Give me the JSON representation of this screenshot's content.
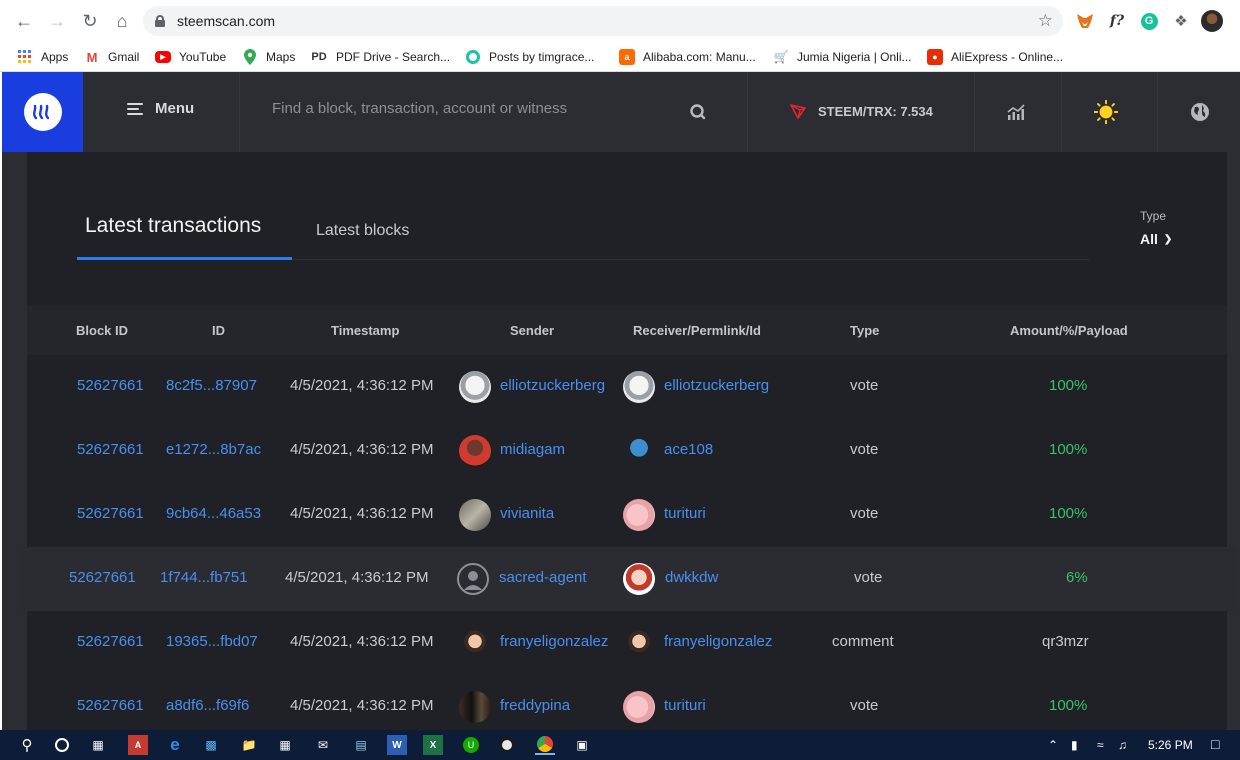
{
  "browser": {
    "url": "steemscan.com",
    "bookmarks": [
      {
        "label": "Apps",
        "icon": "apps-grid-icon",
        "color": "#4285f4"
      },
      {
        "label": "Gmail",
        "icon": "gmail-icon",
        "color": "#ea4335"
      },
      {
        "label": "YouTube",
        "icon": "youtube-icon",
        "color": "#ff0000"
      },
      {
        "label": "Maps",
        "icon": "maps-pin-icon",
        "color": "#34a853"
      },
      {
        "label": "PDF Drive - Search...",
        "icon": "pdf-drive-icon",
        "color": "#333333"
      },
      {
        "label": "Posts by timgrace...",
        "icon": "posts-icon",
        "color": "#19c3a6"
      },
      {
        "label": "Alibaba.com: Manu...",
        "icon": "alibaba-icon",
        "color": "#ff6a00"
      },
      {
        "label": "Jumia Nigeria | Onli...",
        "icon": "jumia-cart-icon",
        "color": "#444444"
      },
      {
        "label": "AliExpress - Online...",
        "icon": "aliexpress-icon",
        "color": "#e62e04"
      }
    ]
  },
  "header": {
    "menu_label": "Menu",
    "search_placeholder": "Find a block, transaction, account or witness",
    "price_label": "STEEM/TRX: 7.534",
    "accent": "#1a3de0"
  },
  "tabs": {
    "active": "Latest transactions",
    "other": "Latest blocks"
  },
  "filter": {
    "label": "Type",
    "value": "All"
  },
  "table": {
    "columns": [
      "Block ID",
      "ID",
      "Timestamp",
      "Sender",
      "Receiver/Permlink/Id",
      "Type",
      "Amount/%/Payload"
    ],
    "rows": [
      {
        "block": "52627661",
        "id": "8c2f5...87907",
        "timestamp": "4/5/2021, 4:36:12 PM",
        "sender": "elliotzuckerberg",
        "receiver": "elliotzuckerberg",
        "type": "vote",
        "amount": "100%"
      },
      {
        "block": "52627661",
        "id": "e1272...8b7ac",
        "timestamp": "4/5/2021, 4:36:12 PM",
        "sender": "midiagam",
        "receiver": "ace108",
        "type": "vote",
        "amount": "100%"
      },
      {
        "block": "52627661",
        "id": "9cb64...46a53",
        "timestamp": "4/5/2021, 4:36:12 PM",
        "sender": "vivianita",
        "receiver": "turituri",
        "type": "vote",
        "amount": "100%"
      },
      {
        "block": "52627661",
        "id": "1f744...fb751",
        "timestamp": "4/5/2021, 4:36:12 PM",
        "sender": "sacred-agent",
        "receiver": "dwkkdw",
        "type": "vote",
        "amount": "6%"
      },
      {
        "block": "52627661",
        "id": "19365...fbd07",
        "timestamp": "4/5/2021, 4:36:12 PM",
        "sender": "franyeligonzalez",
        "receiver": "franyeligonzalez",
        "type": "comment",
        "amount": "qr3mzr"
      },
      {
        "block": "52627661",
        "id": "a8df6...f69f6",
        "timestamp": "4/5/2021, 4:36:12 PM",
        "sender": "freddypina",
        "receiver": "turituri",
        "type": "vote",
        "amount": "100%"
      }
    ]
  },
  "taskbar": {
    "clock": "5:26 PM"
  }
}
